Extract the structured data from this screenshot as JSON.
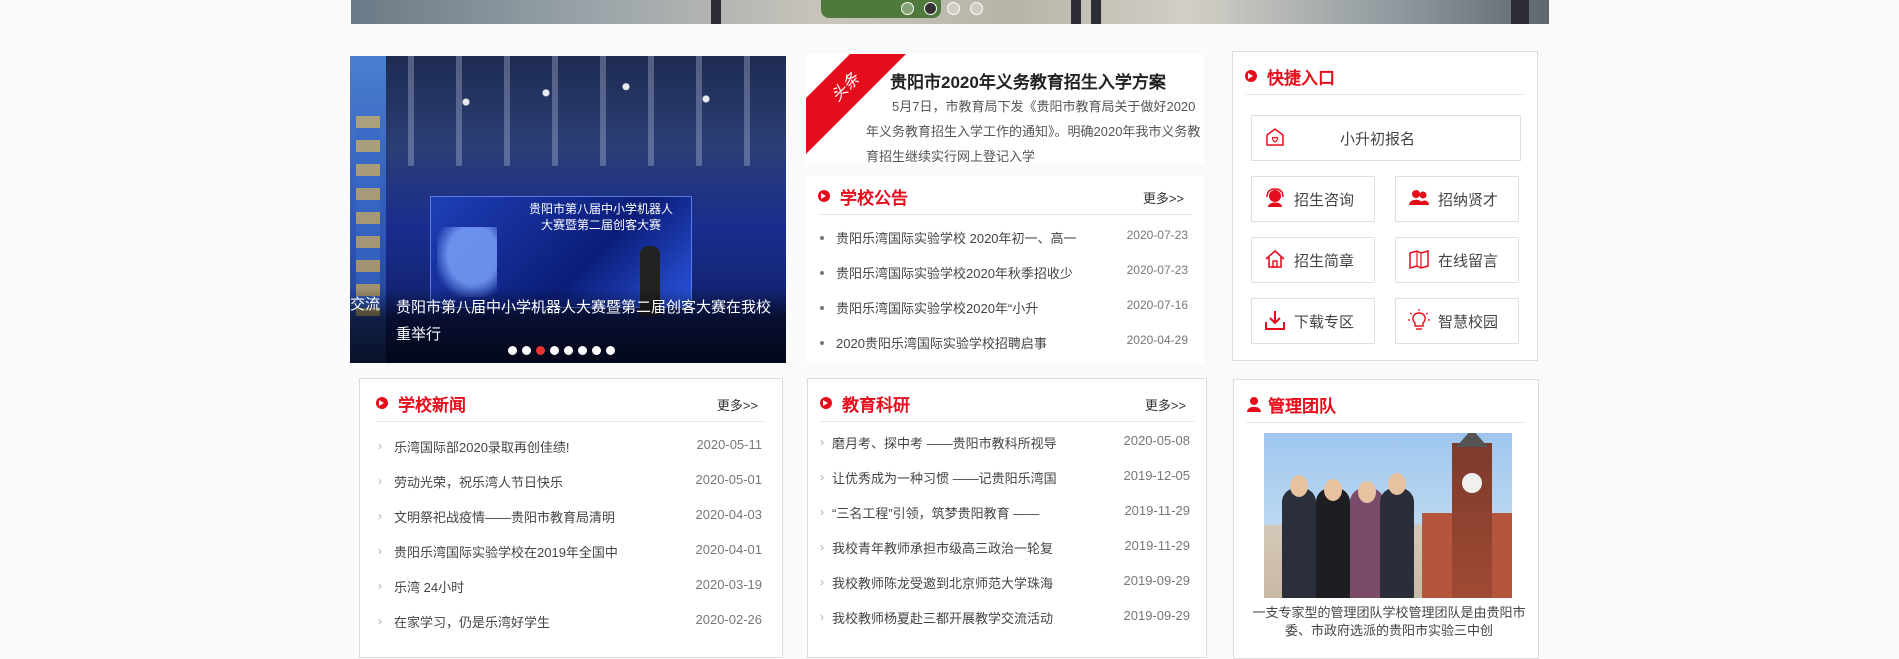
{
  "banner": {
    "dots": 4,
    "active_dot": 2
  },
  "slider": {
    "caption_prev": "交流",
    "caption_line1": "贵阳市第八届中小学机器人大赛暨第二届创客大赛在我校",
    "caption_line2": "重举行",
    "screen_title": "贵阳市第八届中小学机器人大赛暨第二届创客大赛",
    "dots": 8,
    "active_dot": 3
  },
  "headline": {
    "ribbon": "头条",
    "title": "贵阳市2020年义务教育招生入学方案",
    "body": "5月7日，市教育局下发《贵阳市教育局关于做好2020年义务教育招生入学工作的通知》。明确2020年我市义务教育招生继续实行网上登记入学"
  },
  "notice": {
    "title": "学校公告",
    "more": "更多>>",
    "items": [
      {
        "title": "贵阳乐湾国际实验学校 2020年初一、高一",
        "date": "2020-07-23"
      },
      {
        "title": "贵阳乐湾国际实验学校2020年秋季招收少",
        "date": "2020-07-23"
      },
      {
        "title": "贵阳乐湾国际实验学校2020年“小升",
        "date": "2020-07-16"
      },
      {
        "title": "2020贵阳乐湾国际实验学校招聘启事",
        "date": "2020-04-29"
      }
    ]
  },
  "quick": {
    "title": "快捷入口",
    "buttons": [
      {
        "label": "小升初报名",
        "icon": "home-heart-icon"
      },
      {
        "label": "招生咨询",
        "icon": "support-agent-icon"
      },
      {
        "label": "招纳贤才",
        "icon": "users-icon"
      },
      {
        "label": "招生简章",
        "icon": "house-icon"
      },
      {
        "label": "在线留言",
        "icon": "message-book-icon"
      },
      {
        "label": "下载专区",
        "icon": "download-icon"
      },
      {
        "label": "智慧校园",
        "icon": "lightbulb-icon"
      }
    ]
  },
  "news": {
    "title": "学校新闻",
    "more": "更多>>",
    "items": [
      {
        "title": "乐湾国际部2020录取再创佳绩!",
        "date": "2020-05-11"
      },
      {
        "title": "劳动光荣，祝乐湾人节日快乐",
        "date": "2020-05-01"
      },
      {
        "title": "文明祭祀战疫情——贵阳市教育局清明",
        "date": "2020-04-03"
      },
      {
        "title": "贵阳乐湾国际实验学校在2019年全国中",
        "date": "2020-04-01"
      },
      {
        "title": "乐湾 24小时",
        "date": "2020-03-19"
      },
      {
        "title": "在家学习，仍是乐湾好学生",
        "date": "2020-02-26"
      }
    ]
  },
  "research": {
    "title": "教育科研",
    "more": "更多>>",
    "items": [
      {
        "title": "磨月考、探中考 ——贵阳市教科所视导",
        "date": "2020-05-08"
      },
      {
        "title": "让优秀成为一种习惯 ——记贵阳乐湾国",
        "date": "2019-12-05"
      },
      {
        "title": "“三名工程”引领，筑梦贵阳教育 ——",
        "date": "2019-11-29"
      },
      {
        "title": "我校青年教师承担市级高三政治一轮复",
        "date": "2019-11-29"
      },
      {
        "title": "我校教师陈龙受邀到北京师范大学珠海",
        "date": "2019-09-29"
      },
      {
        "title": "我校教师杨夏赴三都开展教学交流活动",
        "date": "2019-09-29"
      }
    ]
  },
  "team": {
    "title": "管理团队",
    "desc": "一支专家型的管理团队学校管理团队是由贵阳市委、市政府选派的贵阳市实验三中创"
  },
  "colors": {
    "accent": "#e50d1b",
    "muted": "#777777"
  }
}
